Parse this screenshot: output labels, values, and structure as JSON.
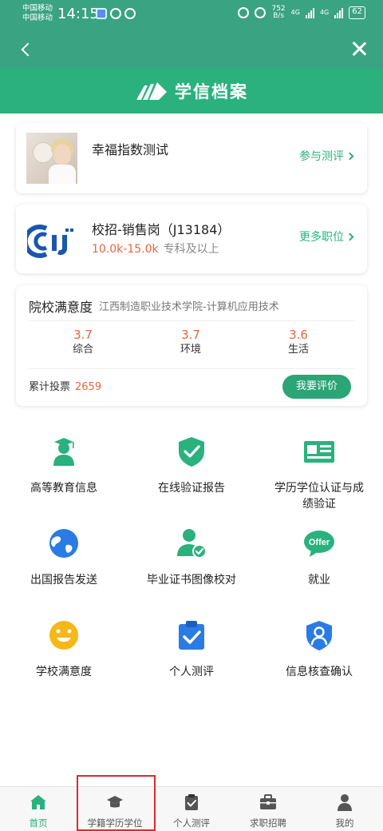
{
  "status_bar": {
    "carrier_1": "中国移动",
    "carrier_2": "中国移动",
    "time": "14:15",
    "speed_value": "752",
    "speed_unit": "B/s",
    "network_1": "4G",
    "network_2": "4G",
    "battery": "62"
  },
  "nav": {
    "back_icon": "chevron-left-icon",
    "close_icon": "close-icon"
  },
  "brand": {
    "name": "学信档案"
  },
  "survey": {
    "title": "幸福指数测试",
    "action": "参与测评"
  },
  "job": {
    "title": "校招-销售岗（J13184）",
    "salary": "10.0k-15.0k",
    "requirement": "专科及以上",
    "action": "更多职位"
  },
  "satisfaction": {
    "title": "院校满意度",
    "school": "江西制造职业技术学院-计算机应用技术",
    "scores": [
      {
        "value": "3.7",
        "label": "综合"
      },
      {
        "value": "3.7",
        "label": "环境"
      },
      {
        "value": "3.6",
        "label": "生活"
      }
    ],
    "votes_label": "累计投票",
    "votes_count": "2659",
    "rate_button": "我要评价"
  },
  "grid": [
    {
      "label": "高等教育信息",
      "icon": "graduate-icon"
    },
    {
      "label": "在线验证报告",
      "icon": "shield-check-icon"
    },
    {
      "label": "学历学位认证与成绩验证",
      "icon": "id-card-icon"
    },
    {
      "label": "出国报告发送",
      "icon": "globe-icon"
    },
    {
      "label": "毕业证书图像校对",
      "icon": "user-check-icon"
    },
    {
      "label": "就业",
      "icon": "offer-icon",
      "badge": "Offer"
    },
    {
      "label": "学校满意度",
      "icon": "smile-icon"
    },
    {
      "label": "个人测评",
      "icon": "clipboard-check-icon"
    },
    {
      "label": "信息核查确认",
      "icon": "shield-user-icon"
    }
  ],
  "tabs": [
    {
      "label": "首页",
      "icon": "home-icon",
      "active": true
    },
    {
      "label": "学籍学历学位",
      "icon": "graduation-cap-icon",
      "active": false
    },
    {
      "label": "个人测评",
      "icon": "clipboard-check-icon",
      "active": false
    },
    {
      "label": "求职招聘",
      "icon": "briefcase-icon",
      "active": false
    },
    {
      "label": "我的",
      "icon": "user-icon",
      "active": false
    }
  ],
  "colors": {
    "primary": "#2bb17e",
    "header": "#3aa382",
    "accent": "#e8643c",
    "highlight": "#e0292d"
  }
}
